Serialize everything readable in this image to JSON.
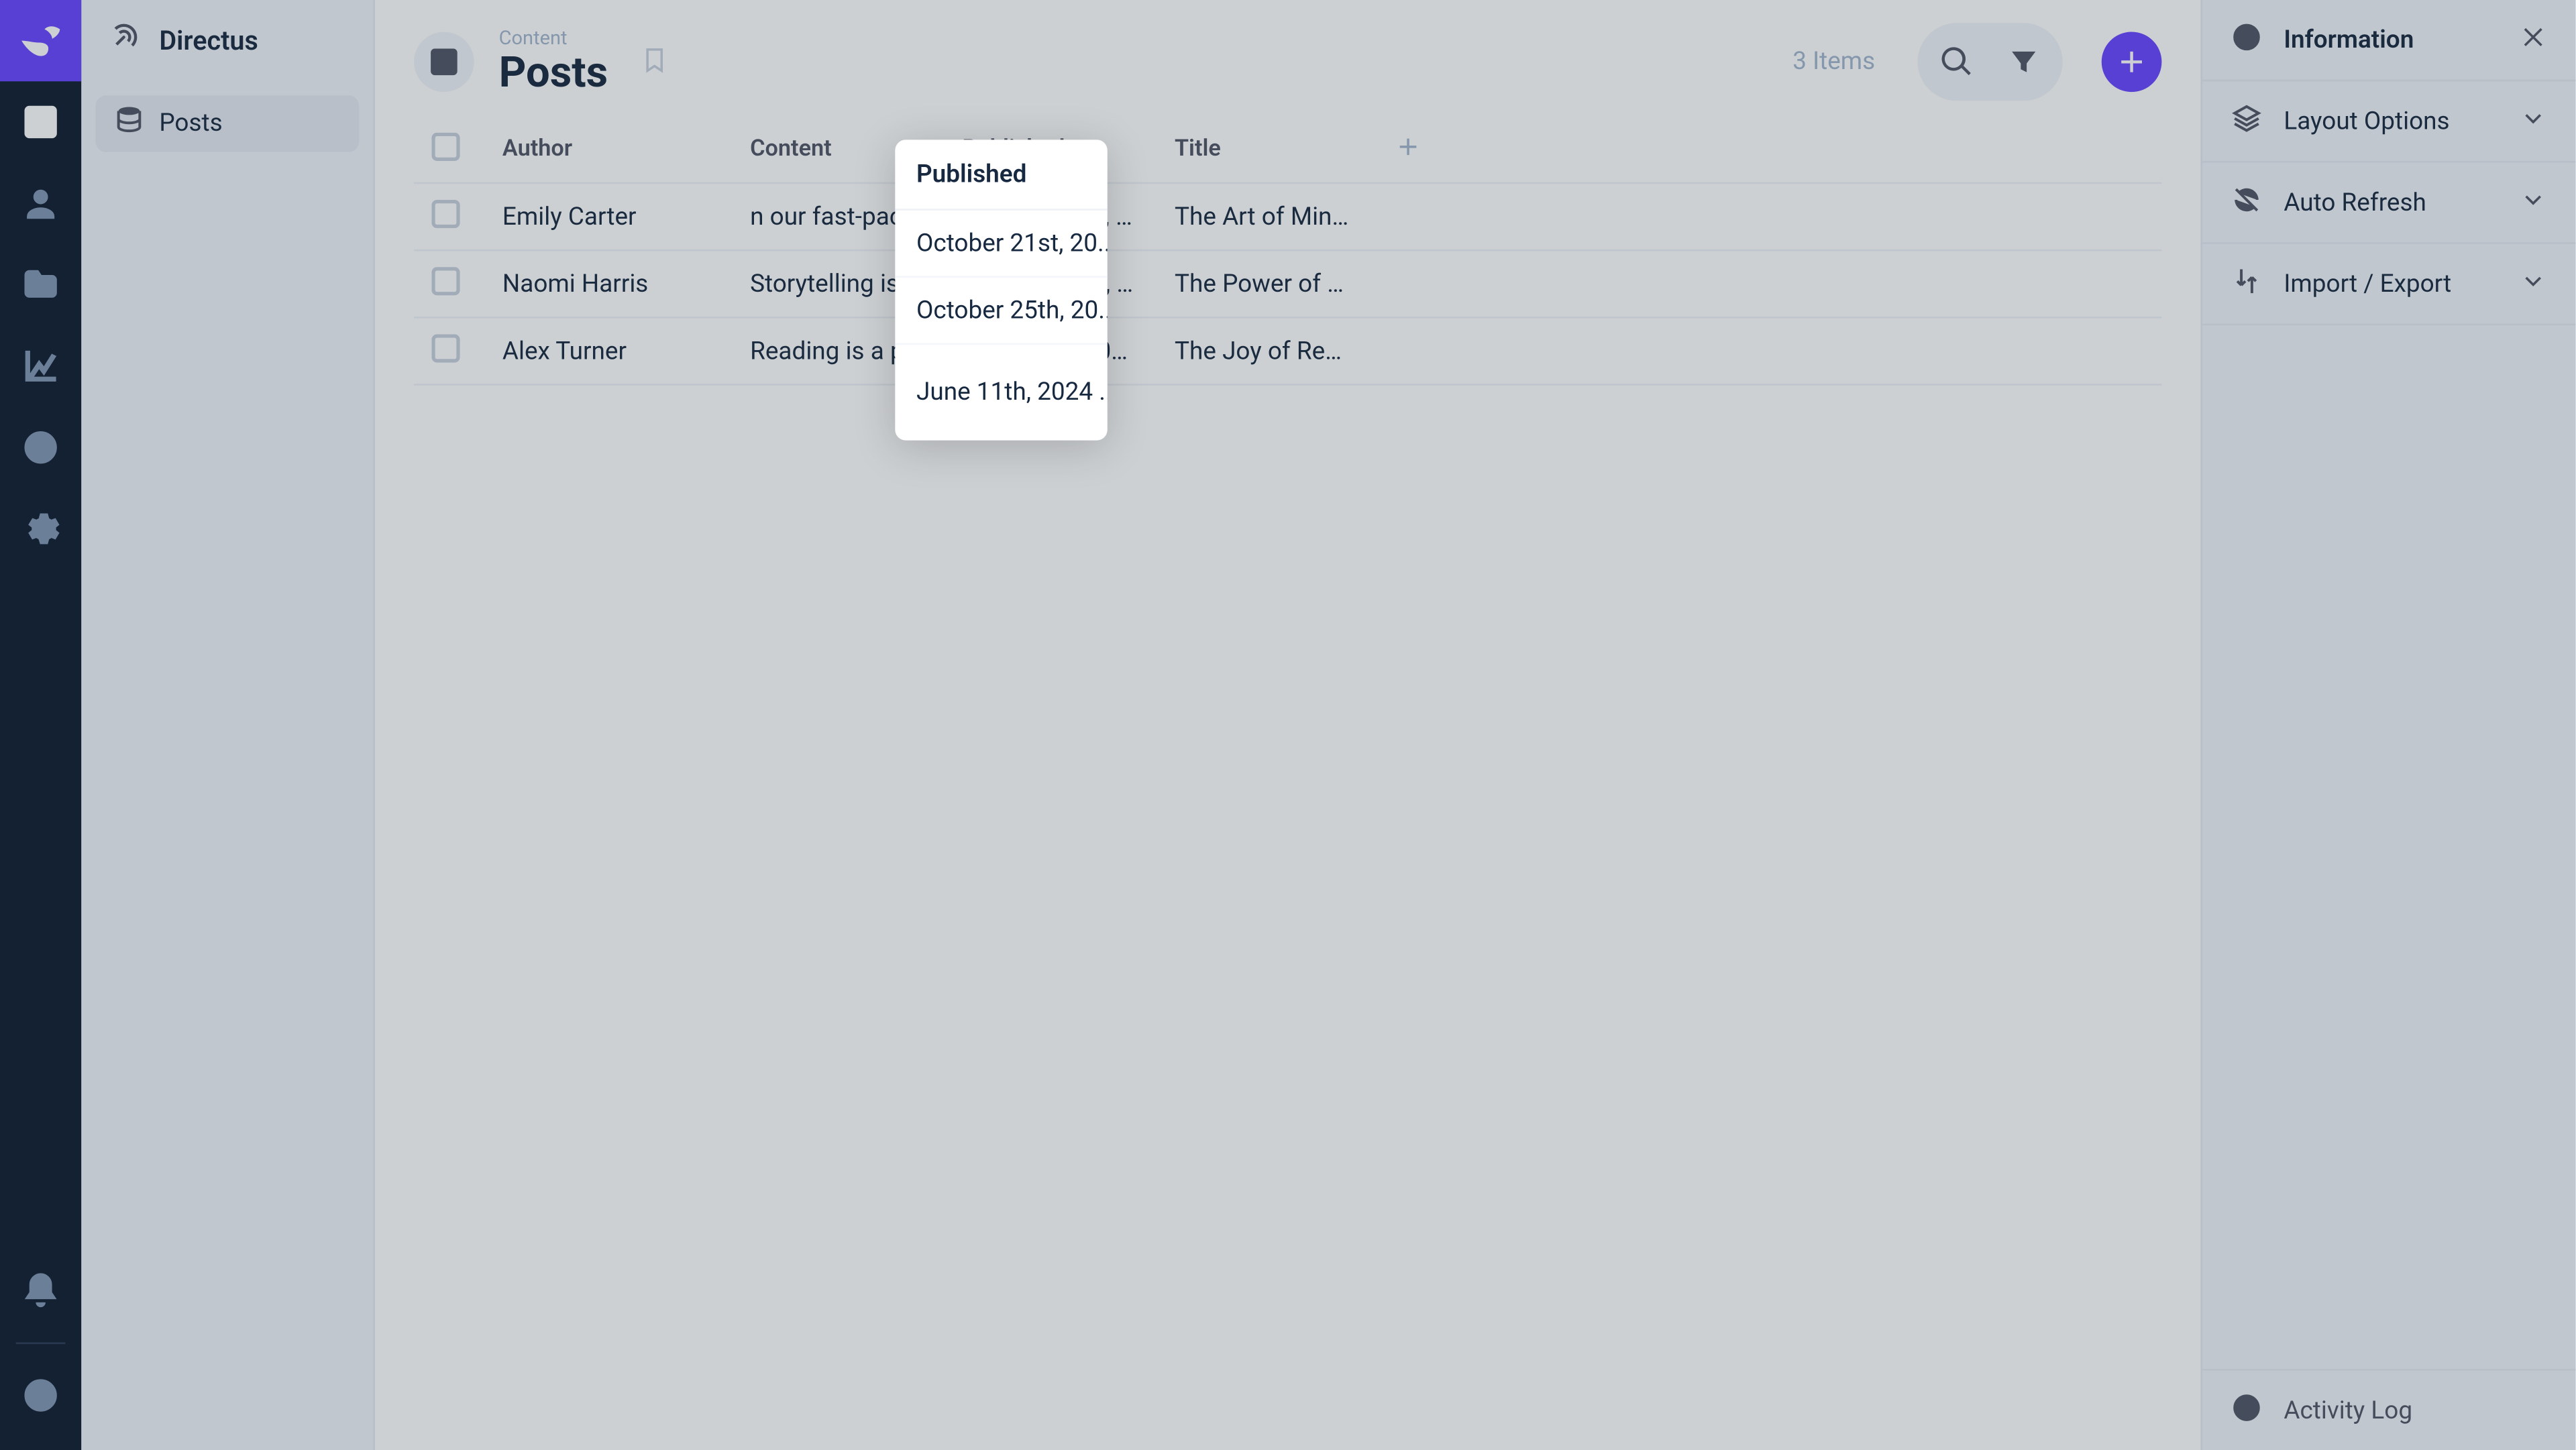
{
  "brand": "Directus",
  "sidebar": {
    "items": [
      {
        "label": "Posts"
      }
    ]
  },
  "breadcrumb": "Content",
  "page_title": "Posts",
  "item_count": "3 Items",
  "table": {
    "columns": {
      "author": "Author",
      "content": "Content",
      "published": "Published",
      "title": "Title"
    },
    "rows": [
      {
        "author": "Emily Carter",
        "content": "n our fast-paced ...",
        "published": "October 21st, 20...",
        "title": "The Art of Minim..."
      },
      {
        "author": "Naomi Harris",
        "content": "Storytelling is a u...",
        "published": "October 25th, 20...",
        "title": "The Power of Sto..."
      },
      {
        "author": "Alex Turner",
        "content": "Reading is a pow...",
        "published": "June 11th, 2024 ...",
        "title": "The Joy of Readi..."
      }
    ]
  },
  "panel": {
    "info": "Information",
    "layout": "Layout Options",
    "refresh": "Auto Refresh",
    "importexport": "Import / Export",
    "activity": "Activity Log"
  },
  "popover": {
    "header": "Published",
    "rows": [
      "October 21st, 20...",
      "October 25th, 20...",
      "June 11th, 2024 ..."
    ]
  }
}
